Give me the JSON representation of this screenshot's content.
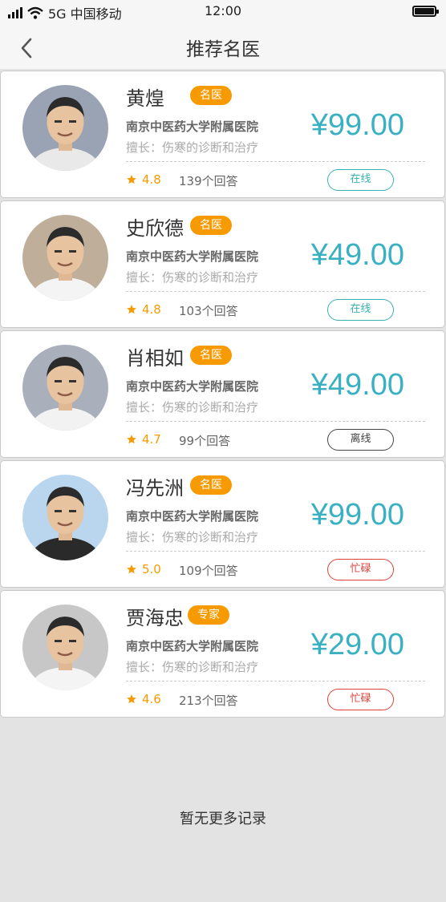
{
  "status_bar": {
    "carrier": "5G 中国移动",
    "time": "12:00"
  },
  "nav": {
    "title": "推荐名医"
  },
  "doctors": [
    {
      "name": "黄煌",
      "badge": "名医",
      "hospital": "南京中医药大学附属医院",
      "specialty": "擅长：伤寒的诊断和治疗",
      "price": "¥99.00",
      "rating": "4.8",
      "answers": "139个回答",
      "status": "在线",
      "status_color": "#3ab0b0",
      "shirt_color": "#e9e9e9",
      "bg_color": "#9aa3b3"
    },
    {
      "name": "史欣德",
      "badge": "名医",
      "hospital": "南京中医药大学附属医院",
      "specialty": "擅长：伤寒的诊断和治疗",
      "price": "¥49.00",
      "rating": "4.8",
      "answers": "103个回答",
      "status": "在线",
      "status_color": "#3ab0b0",
      "shirt_color": "#f4f4f4",
      "bg_color": "#bfae9a"
    },
    {
      "name": "肖相如",
      "badge": "名医",
      "hospital": "南京中医药大学附属医院",
      "specialty": "擅长：伤寒的诊断和治疗",
      "price": "¥49.00",
      "rating": "4.7",
      "answers": "99个回答",
      "status": "离线",
      "status_color": "#444444",
      "shirt_color": "#f2f2f2",
      "bg_color": "#aab0bb"
    },
    {
      "name": "冯先洲",
      "badge": "名医",
      "hospital": "南京中医药大学附属医院",
      "specialty": "擅长：伤寒的诊断和治疗",
      "price": "¥99.00",
      "rating": "5.0",
      "answers": "109个回答",
      "status": "忙碌",
      "status_color": "#e0403a",
      "shirt_color": "#2a2a2a",
      "bg_color": "#b9d6ee"
    },
    {
      "name": "贾海忠",
      "badge": "专家",
      "hospital": "南京中医药大学附属医院",
      "specialty": "擅长：伤寒的诊断和治疗",
      "price": "¥29.00",
      "rating": "4.6",
      "answers": "213个回答",
      "status": "忙碌",
      "status_color": "#e0403a",
      "shirt_color": "#f4f4f4",
      "bg_color": "#c7c7c7"
    }
  ],
  "footer": {
    "note": "暂无更多记录"
  },
  "colors": {
    "accent": "#3ab0c3",
    "badge": "#f79a00",
    "online": "#3ab0b0",
    "busy": "#e0403a",
    "offline": "#444444"
  },
  "icons": {
    "back": "chevron-left-icon",
    "star": "star-icon",
    "signal": "signal-icon",
    "wifi": "wifi-icon",
    "battery": "battery-icon"
  }
}
